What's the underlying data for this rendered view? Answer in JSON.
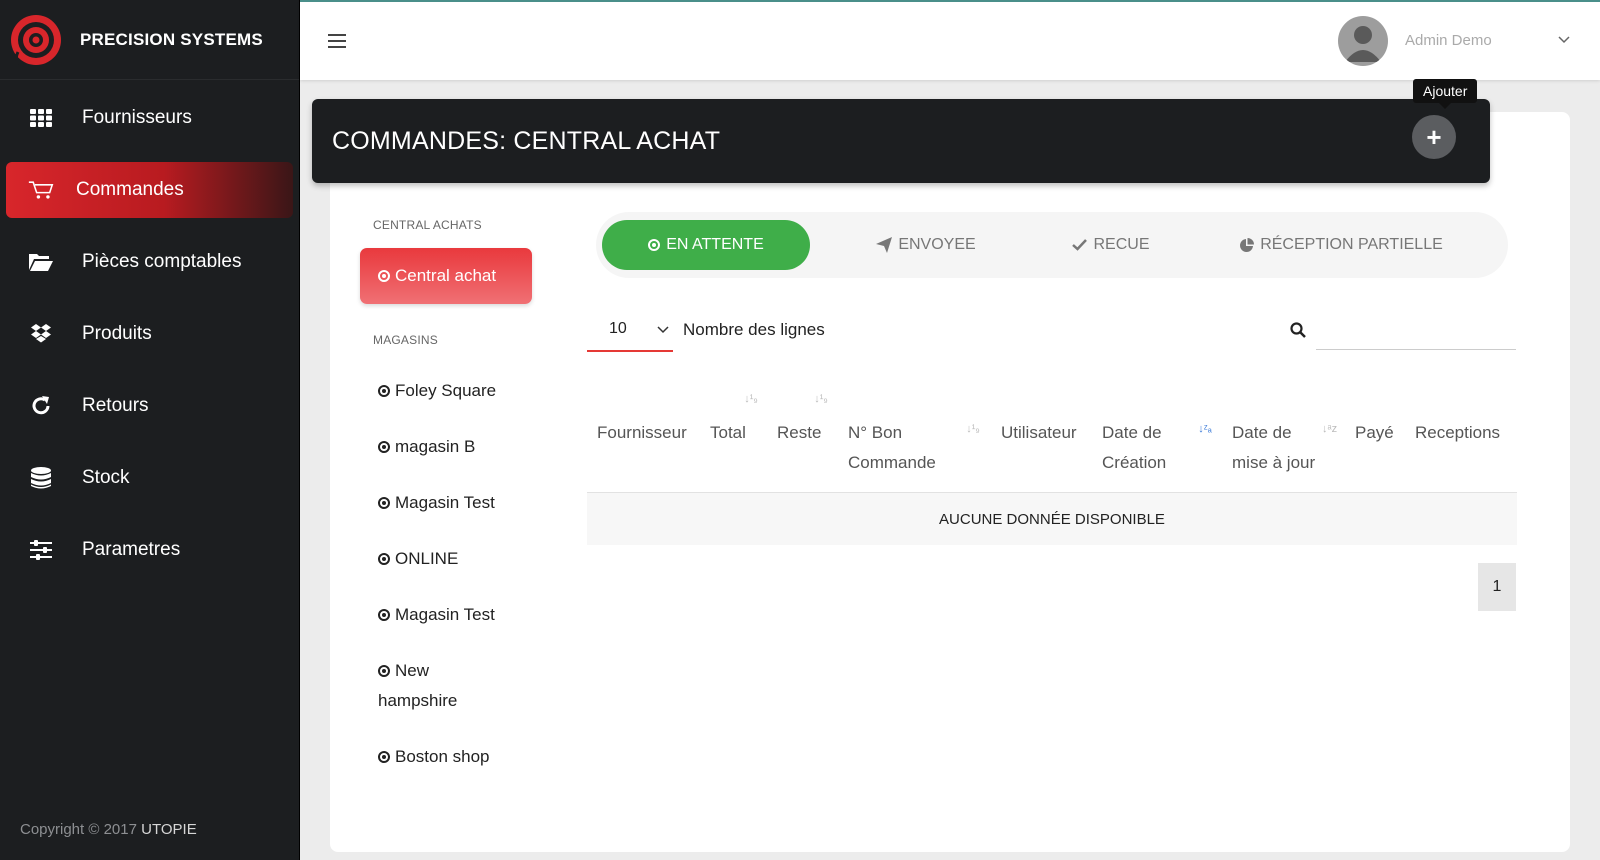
{
  "brand": {
    "name": "PRECISION SYSTEMS",
    "logo_color": "#d8262b"
  },
  "sidebar": {
    "items": [
      {
        "label": "Fournisseurs",
        "icon": "grid-icon"
      },
      {
        "label": "Commandes",
        "icon": "cart-icon",
        "active": true
      },
      {
        "label": "Pièces comptables",
        "icon": "folder-open-icon"
      },
      {
        "label": "Produits",
        "icon": "dropbox-icon"
      },
      {
        "label": "Retours",
        "icon": "refresh-icon"
      },
      {
        "label": "Stock",
        "icon": "database-icon"
      },
      {
        "label": "Parametres",
        "icon": "sliders-icon"
      }
    ],
    "copyright_prefix": "Copyright © 2017",
    "copyright_company": "UTOPIE"
  },
  "topbar": {
    "user_name": "Admin Demo"
  },
  "header": {
    "title": "COMMANDES: CENTRAL ACHAT",
    "add_tooltip": "Ajouter",
    "add_symbol": "+"
  },
  "stores": {
    "central_label": "CENTRAL ACHATS",
    "central_item": "Central achat",
    "magasins_label": "MAGASINS",
    "items": [
      "Foley Square",
      "magasin B",
      "Magasin Test",
      "ONLINE",
      "Magasin Test",
      "New hampshire",
      "Boston shop"
    ]
  },
  "tabs": [
    {
      "label": "EN ATTENTE",
      "active": true
    },
    {
      "label": "ENVOYEE"
    },
    {
      "label": "RECUE"
    },
    {
      "label": "RÉCEPTION PARTIELLE"
    }
  ],
  "table": {
    "length_value": "10",
    "length_label": "Nombre des lignes",
    "search_value": "",
    "columns": [
      "Fournisseur",
      "Total",
      "Reste",
      "N° Bon Commande",
      "Utilisateur",
      "Date de Création",
      "Date de mise à jour",
      "Payé",
      "Receptions"
    ],
    "empty_message": "AUCUNE DONNÉE DISPONIBLE",
    "page": "1"
  },
  "colors": {
    "accent_red": "#d8262b",
    "active_tab_green": "#3fae49",
    "sort_active_blue": "#3b7bd8"
  }
}
